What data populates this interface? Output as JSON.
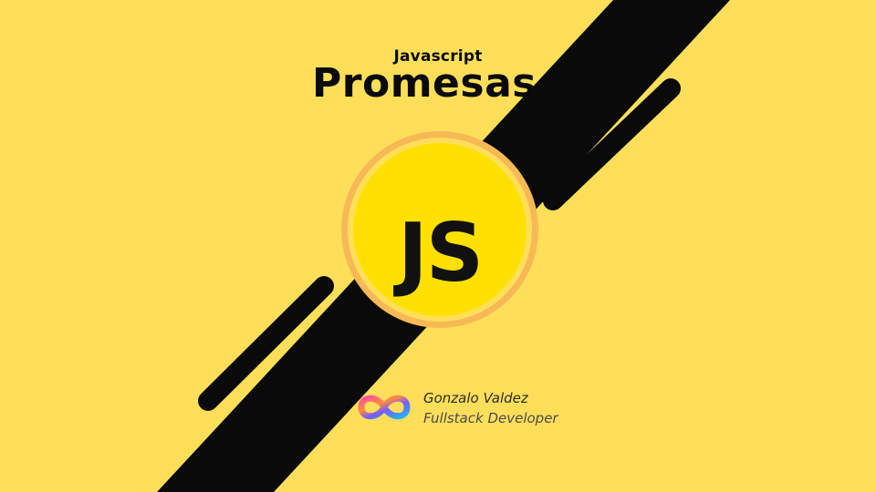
{
  "header": {
    "subtitle": "Javascript",
    "title": "Promesas"
  },
  "logo": {
    "text": "JS",
    "icon": "js-logo-icon"
  },
  "author": {
    "name": "Gonzalo Valdez",
    "role": "Fullstack Developer",
    "icon": "infinity-logo-icon"
  },
  "colors": {
    "background": "#FFDF5A",
    "stripe": "#0A0A0A",
    "circle_fill": "#FFE000",
    "circle_ring": "#F7B955"
  }
}
